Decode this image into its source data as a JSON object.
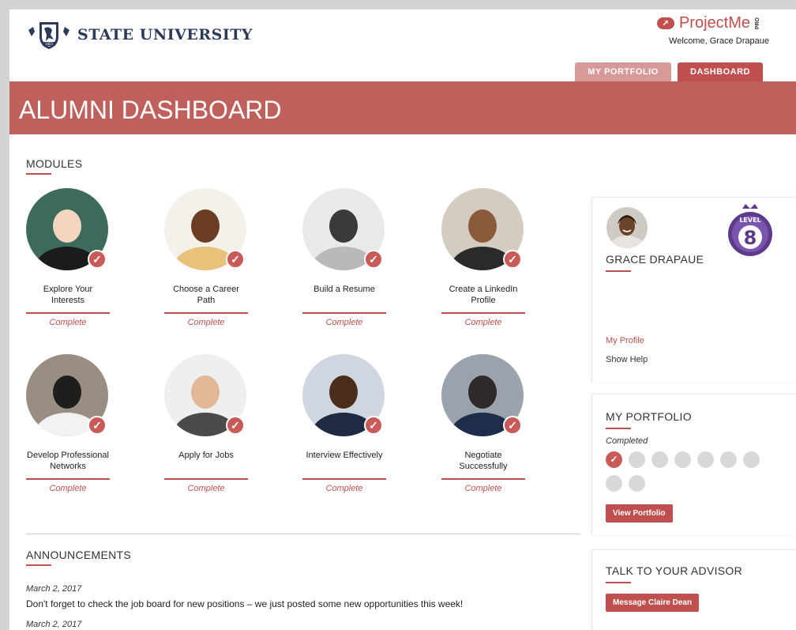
{
  "header": {
    "university_name": "STATE UNIVERSITY",
    "crest_year": "1855",
    "brand_name": "ProjectMe",
    "brand_suffix": "PRO",
    "welcome_text": "Welcome, Grace Drapaue",
    "tabs": [
      {
        "label": "MY PORTFOLIO",
        "active": false
      },
      {
        "label": "DASHBOARD",
        "active": true
      }
    ]
  },
  "banner": {
    "title": "ALUMNI DASHBOARD"
  },
  "modules": {
    "heading": "MODULES",
    "items": [
      {
        "title_line1": "Explore Your",
        "title_line2": "Interests",
        "status": "Complete",
        "image": "person-thinking-icon"
      },
      {
        "title_line1": "Choose a Career",
        "title_line2": "Path",
        "status": "Complete",
        "image": "man-thinking-icon"
      },
      {
        "title_line1": "Build a Resume",
        "title_line2": "",
        "status": "Complete",
        "image": "resume-pen-icon"
      },
      {
        "title_line1": "Create a LinkedIn",
        "title_line2": "Profile",
        "status": "Complete",
        "image": "laptop-woman-icon"
      },
      {
        "title_line1": "Develop Professional",
        "title_line2": "Networks",
        "status": "Complete",
        "image": "business-card-icon"
      },
      {
        "title_line1": "Apply for Jobs",
        "title_line2": "",
        "status": "Complete",
        "image": "signing-document-icon"
      },
      {
        "title_line1": "Interview Effectively",
        "title_line2": "",
        "status": "Complete",
        "image": "interview-handshake-icon"
      },
      {
        "title_line1": "Negotiate",
        "title_line2": "Successfully",
        "status": "Complete",
        "image": "business-meeting-icon"
      }
    ]
  },
  "announcements": {
    "heading": "ANNOUNCEMENTS",
    "items": [
      {
        "date": "March 2, 2017",
        "text": "Don't forget to check the job board for new positions – we just posted some new opportunities this week!"
      },
      {
        "date": "March 2, 2017",
        "text": ""
      }
    ]
  },
  "profile": {
    "name": "GRACE DRAPAUE",
    "level_label": "LEVEL",
    "level_value": "8",
    "links": [
      "My Profile",
      "Show Help"
    ]
  },
  "portfolio": {
    "title": "MY PORTFOLIO",
    "completed_label": "Completed",
    "progress_completed": 1,
    "progress_total": 9,
    "button_label": "View Portfolio"
  },
  "advisor": {
    "title": "TALK TO YOUR ADVISOR",
    "button_label": "Message Claire Dean"
  },
  "colors": {
    "accent": "#c0504d",
    "banner": "#c0605d",
    "tab_inactive": "#d79a98",
    "navy": "#2c3a5a"
  }
}
